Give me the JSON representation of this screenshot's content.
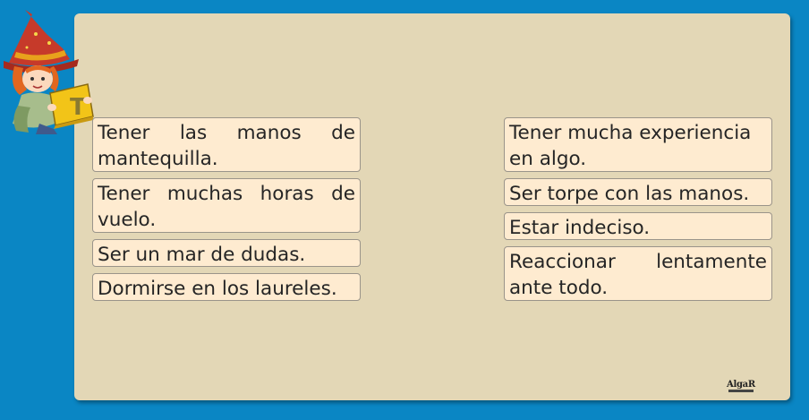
{
  "left_column": [
    {
      "text": "Tener las manos de mantequilla."
    },
    {
      "text": "Tener muchas horas de vuelo."
    },
    {
      "text": "Ser un mar de dudas."
    },
    {
      "text": "Dormirse en los laureles."
    }
  ],
  "right_column": [
    {
      "text": "Tener mucha experiencia en algo."
    },
    {
      "text": "Ser torpe con las manos."
    },
    {
      "text": "Estar indeciso."
    },
    {
      "text": "Reaccionar lentamente ante todo."
    }
  ],
  "mascot": {
    "book_letter": "T"
  },
  "publisher_logo": {
    "text": "AlgaR"
  },
  "colors": {
    "background": "#0a86c4",
    "board": "#e3d7b6",
    "card": "#feebd0",
    "card_border": "#9a948a",
    "hat": "#c63a2a",
    "book": "#f2c418"
  }
}
